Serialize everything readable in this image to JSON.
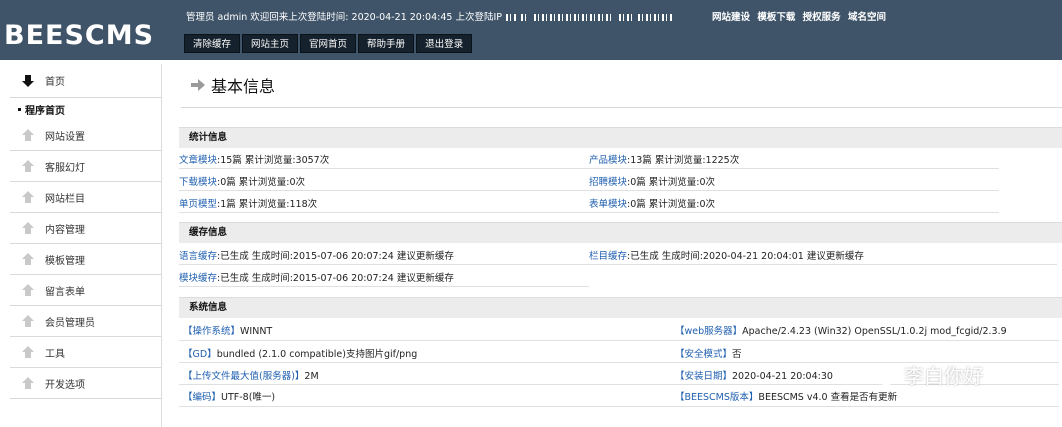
{
  "header": {
    "logo": "BEESCMS",
    "welcome_prefix": "管理员 admin 欢迎回来上次登陆时间: 2020-04-21 20:04:45 上次登陆IP",
    "links": [
      "网站建设",
      "模板下载",
      "授权服务",
      "域名空间"
    ],
    "buttons": [
      "清除缓存",
      "网站主页",
      "官网首页",
      "帮助手册",
      "退出登录"
    ]
  },
  "sidebar": {
    "items": [
      "首页",
      "网站设置",
      "客服幻灯",
      "网站栏目",
      "内容管理",
      "模板管理",
      "留言表单",
      "会员管理员",
      "工具",
      "开发选项"
    ],
    "sub_item": "程序首页"
  },
  "main": {
    "title": "基本信息",
    "stats": {
      "heading": "统计信息",
      "rows": [
        {
          "label": "文章模块",
          "text": ":15篇 累计浏览量:3057次"
        },
        {
          "label": "产品模块",
          "text": ":13篇 累计浏览量:1225次"
        },
        {
          "label": "下载模块",
          "text": ":0篇 累计浏览量:0次"
        },
        {
          "label": "招聘模块",
          "text": ":0篇 累计浏览量:0次"
        },
        {
          "label": "单页模型",
          "text": ":1篇 累计浏览量:118次"
        },
        {
          "label": "表单模块",
          "text": ":0篇 累计浏览量:0次"
        }
      ]
    },
    "cache": {
      "heading": "缓存信息",
      "rows": [
        {
          "label": "语言缓存",
          "text": ":已生成  生成时间:2015-07-06 20:07:24 建议更新缓存"
        },
        {
          "label": "栏目缓存",
          "text": ":已生成  生成时间:2020-04-21 20:04:01 建议更新缓存"
        },
        {
          "label": "模块缓存",
          "text": ":已生成  生成时间:2015-07-06 20:07:24 建议更新缓存"
        }
      ]
    },
    "system": {
      "heading": "系统信息",
      "rows": [
        {
          "label": "【操作系统】",
          "text": "WINNT"
        },
        {
          "label": "【web服务器】",
          "text": "Apache/2.4.23 (Win32) OpenSSL/1.0.2j mod_fcgid/2.3.9"
        },
        {
          "label": "【GD】",
          "text": "bundled (2.1.0 compatible)支持图片gif/png"
        },
        {
          "label": "【安全模式】",
          "text": "否"
        },
        {
          "label": "【上传文件最大值(服务器)】",
          "text": "2M"
        },
        {
          "label": "【安装日期】",
          "text": "2020-04-21 20:04:30"
        },
        {
          "label": "【编码】",
          "text": "UTF-8(唯一)"
        },
        {
          "label": "【BEESCMS版本】",
          "text": "BEESCMS v4.0  查看是否有更新"
        }
      ]
    }
  },
  "watermark": "李白你好"
}
